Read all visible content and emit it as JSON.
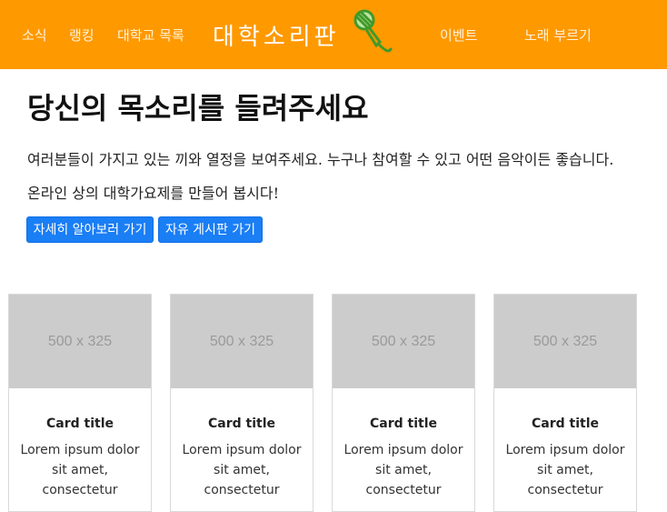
{
  "navbar": {
    "links_left": [
      "소식",
      "랭킹",
      "대학교 목록"
    ],
    "brand": "대학소리판",
    "links_right": [
      "이벤트",
      "노래 부르기"
    ],
    "background_color": "#ff9900",
    "brand_icon": "microphone-icon"
  },
  "hero": {
    "title": "당신의 목소리를 들려주세요",
    "line1": "여러분들이 가지고 있는 끼와 열정을 보여주세요. 누구나 참여할 수 있고 어떤 음악이든 좋습니다.",
    "line2": "온라인 상의 대학가요제를 만들어 봅시다!",
    "btn_learn_more": "자세히 알아보러 가기",
    "btn_free_board": "자유 게시판 가기",
    "button_color": "#1a7ef5"
  },
  "cards": [
    {
      "image_label": "500 x 325",
      "title": "Card title",
      "text": "Lorem ipsum dolor sit amet, consectetur"
    },
    {
      "image_label": "500 x 325",
      "title": "Card title",
      "text": "Lorem ipsum dolor sit amet, consectetur"
    },
    {
      "image_label": "500 x 325",
      "title": "Card title",
      "text": "Lorem ipsum dolor sit amet, consectetur"
    },
    {
      "image_label": "500 x 325",
      "title": "Card title",
      "text": "Lorem ipsum dolor sit amet, consectetur"
    }
  ]
}
